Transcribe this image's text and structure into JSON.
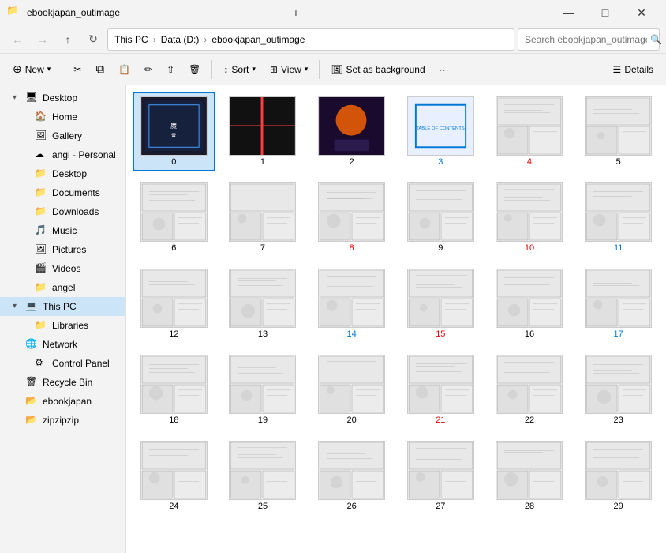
{
  "titlebar": {
    "title": "ebookjapan_outimage",
    "icon": "📁",
    "minimize": "—",
    "maximize": "□",
    "close": "✕"
  },
  "navbar": {
    "back_label": "←",
    "forward_label": "→",
    "up_label": "↑",
    "refresh_label": "↻",
    "address_segments": [
      "This PC",
      "Data (D:)",
      "ebookjapan_outimage"
    ],
    "search_placeholder": "Search ebookjapan_outimage"
  },
  "toolbar": {
    "new_label": "New",
    "cut_label": "✂",
    "copy_label": "⧉",
    "paste_label": "📋",
    "rename_label": "✏",
    "share_label": "⇧",
    "delete_label": "🗑",
    "sort_label": "Sort",
    "view_label": "View",
    "set_bg_label": "Set as background",
    "more_label": "···",
    "details_label": "Details"
  },
  "sidebar": {
    "items": [
      {
        "id": "desktop1",
        "label": "Desktop",
        "icon": "desktop",
        "indent": 1,
        "expand": "▾",
        "expanded": true
      },
      {
        "id": "home",
        "label": "Home",
        "icon": "home",
        "indent": 2,
        "expand": "",
        "expanded": false
      },
      {
        "id": "gallery",
        "label": "Gallery",
        "icon": "gallery",
        "indent": 2,
        "expand": "",
        "expanded": false
      },
      {
        "id": "angi",
        "label": "angi - Personal",
        "icon": "cloud",
        "indent": 2,
        "expand": "",
        "expanded": false
      },
      {
        "id": "desktop2",
        "label": "Desktop",
        "icon": "folder",
        "indent": 2,
        "expand": "",
        "expanded": false
      },
      {
        "id": "documents",
        "label": "Documents",
        "icon": "folder",
        "indent": 2,
        "expand": "",
        "expanded": false
      },
      {
        "id": "downloads",
        "label": "Downloads",
        "icon": "folder",
        "indent": 2,
        "expand": "",
        "expanded": false
      },
      {
        "id": "music",
        "label": "Music",
        "icon": "music",
        "indent": 2,
        "expand": "",
        "expanded": false
      },
      {
        "id": "pictures",
        "label": "Pictures",
        "icon": "pictures",
        "indent": 2,
        "expand": "",
        "expanded": false
      },
      {
        "id": "videos",
        "label": "Videos",
        "icon": "videos",
        "indent": 2,
        "expand": "",
        "expanded": false
      },
      {
        "id": "angel",
        "label": "angel",
        "icon": "folder",
        "indent": 2,
        "expand": "",
        "expanded": false
      },
      {
        "id": "thispc",
        "label": "This PC",
        "icon": "computer",
        "indent": 1,
        "expand": "▾",
        "expanded": true,
        "selected": true
      },
      {
        "id": "libraries",
        "label": "Libraries",
        "icon": "folder",
        "indent": 2,
        "expand": "",
        "expanded": false
      },
      {
        "id": "network",
        "label": "Network",
        "icon": "network",
        "indent": 1,
        "expand": "",
        "expanded": false
      },
      {
        "id": "controlpanel",
        "label": "Control Panel",
        "icon": "controlpanel",
        "indent": 2,
        "expand": "",
        "expanded": false
      },
      {
        "id": "recylebin",
        "label": "Recycle Bin",
        "icon": "recyclebin",
        "indent": 1,
        "expand": "",
        "expanded": false
      },
      {
        "id": "ebookjapan",
        "label": "ebookjapan",
        "icon": "folder_yellow",
        "indent": 1,
        "expand": "",
        "expanded": false
      },
      {
        "id": "zipzipzip",
        "label": "zipzipzip",
        "icon": "folder_yellow",
        "indent": 1,
        "expand": "",
        "expanded": false
      }
    ]
  },
  "thumbnails": [
    {
      "num": "0",
      "selected": true,
      "color": "black"
    },
    {
      "num": "1",
      "selected": false,
      "color": "black"
    },
    {
      "num": "2",
      "selected": false,
      "color": "black"
    },
    {
      "num": "3",
      "selected": false,
      "color": "blue",
      "hasBox": true
    },
    {
      "num": "4",
      "selected": false,
      "color": "red"
    },
    {
      "num": "5",
      "selected": false,
      "color": "black"
    },
    {
      "num": "6",
      "selected": false,
      "color": "black"
    },
    {
      "num": "7",
      "selected": false,
      "color": "black"
    },
    {
      "num": "8",
      "selected": false,
      "color": "red"
    },
    {
      "num": "9",
      "selected": false,
      "color": "black"
    },
    {
      "num": "10",
      "selected": false,
      "color": "red"
    },
    {
      "num": "11",
      "selected": false,
      "color": "blue"
    },
    {
      "num": "12",
      "selected": false,
      "color": "black"
    },
    {
      "num": "13",
      "selected": false,
      "color": "black"
    },
    {
      "num": "14",
      "selected": false,
      "color": "blue"
    },
    {
      "num": "15",
      "selected": false,
      "color": "red"
    },
    {
      "num": "16",
      "selected": false,
      "color": "black"
    },
    {
      "num": "17",
      "selected": false,
      "color": "blue"
    },
    {
      "num": "18",
      "selected": false,
      "color": "black"
    },
    {
      "num": "19",
      "selected": false,
      "color": "black"
    },
    {
      "num": "20",
      "selected": false,
      "color": "black"
    },
    {
      "num": "21",
      "selected": false,
      "color": "red"
    },
    {
      "num": "22",
      "selected": false,
      "color": "black"
    },
    {
      "num": "23",
      "selected": false,
      "color": "black"
    },
    {
      "num": "24",
      "selected": false,
      "color": "black"
    },
    {
      "num": "25",
      "selected": false,
      "color": "black"
    },
    {
      "num": "26",
      "selected": false,
      "color": "black"
    },
    {
      "num": "27",
      "selected": false,
      "color": "black"
    },
    {
      "num": "28",
      "selected": false,
      "color": "black"
    },
    {
      "num": "29",
      "selected": false,
      "color": "black"
    }
  ]
}
